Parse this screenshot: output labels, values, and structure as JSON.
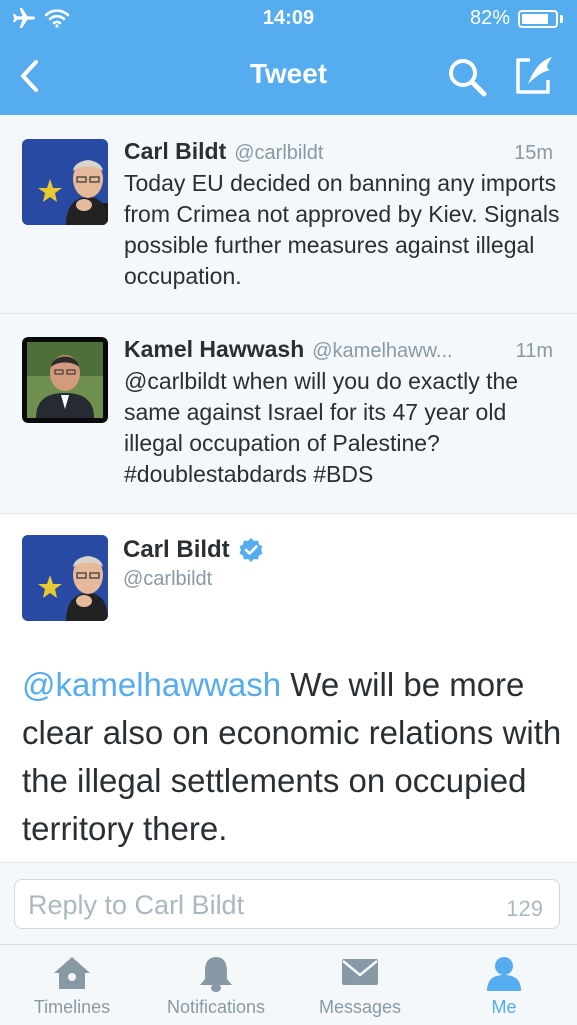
{
  "status": {
    "time": "14:09",
    "battery": "82%",
    "battery_level": 0.82
  },
  "nav": {
    "title": "Tweet",
    "back_icon": "chevron-left-icon",
    "search_icon": "search-icon",
    "compose_icon": "compose-icon"
  },
  "tweets": [
    {
      "name": "Carl Bildt",
      "handle": "@carlbildt",
      "time": "15m",
      "text": "Today EU decided on banning any imports from Crimea not approved by Kiev.  Signals possible further measures against illegal occupation."
    },
    {
      "name": "Kamel Hawwash",
      "handle": "@kamelhaww...",
      "time": "11m",
      "text": "@carlbildt when will you do exactly the same against Israel for its 47 year old illegal occupation of Palestine? #doublestabdards #BDS"
    }
  ],
  "main_tweet": {
    "name": "Carl Bildt",
    "handle": "@carlbildt",
    "mention": "@kamelhawwash",
    "text": " We will be more clear also on economic relations with the illegal settlements on occupied territory there."
  },
  "reply": {
    "placeholder": "Reply to Carl Bildt",
    "count": "129"
  },
  "tabs": [
    {
      "label": "Timelines",
      "icon": "home-icon"
    },
    {
      "label": "Notifications",
      "icon": "bell-icon"
    },
    {
      "label": "Messages",
      "icon": "envelope-icon"
    },
    {
      "label": "Me",
      "icon": "person-icon",
      "active": true
    }
  ],
  "colors": {
    "accent": "#55acee",
    "muted": "#8899a6",
    "text": "#292f33",
    "verified": "#55acee"
  }
}
